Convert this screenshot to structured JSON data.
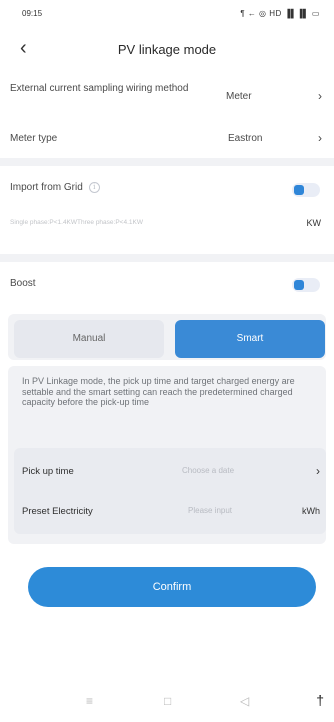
{
  "status_bar": {
    "time": "09:15",
    "icons": "¶ ← ◎ HD ▐▌▐▌ ▭"
  },
  "header": {
    "back_icon": "back-arrow-icon",
    "back_glyph": "‹",
    "title": "PV linkage mode"
  },
  "settings": {
    "sampling": {
      "label": "External current sampling wiring method",
      "value": "Meter",
      "chevron": "›"
    },
    "meter_type": {
      "label": "Meter type",
      "value": "Eastron",
      "chevron": "›"
    }
  },
  "import_from_grid": {
    "label": "Import from Grid",
    "info_glyph": "i",
    "enabled": true,
    "hint": "Single phase:P<1.4KWThree phase:P<4.1KW",
    "unit": "KW"
  },
  "boost": {
    "label": "Boost",
    "enabled": true
  },
  "mode_tabs": {
    "manual": "Manual",
    "smart": "Smart",
    "selected": "Smart"
  },
  "smart_panel": {
    "description": "In PV Linkage mode, the pick up time and target charged energy are settable and the smart setting can reach the predetermined charged capacity before the pick-up time",
    "pickup": {
      "label": "Pick up time",
      "placeholder": "Choose a date",
      "chevron": "›"
    },
    "preset": {
      "label": "Preset Electricity",
      "placeholder": "Please input",
      "unit": "kWh"
    }
  },
  "confirm_label": "Confirm",
  "nav_bar": {
    "menu": "≡",
    "home": "□",
    "back": "◁",
    "accessibility": "†"
  },
  "colors": {
    "accent": "#2d8bd8",
    "panel_bg": "#f1f2f5",
    "inner_bg": "#e9ebf0"
  }
}
